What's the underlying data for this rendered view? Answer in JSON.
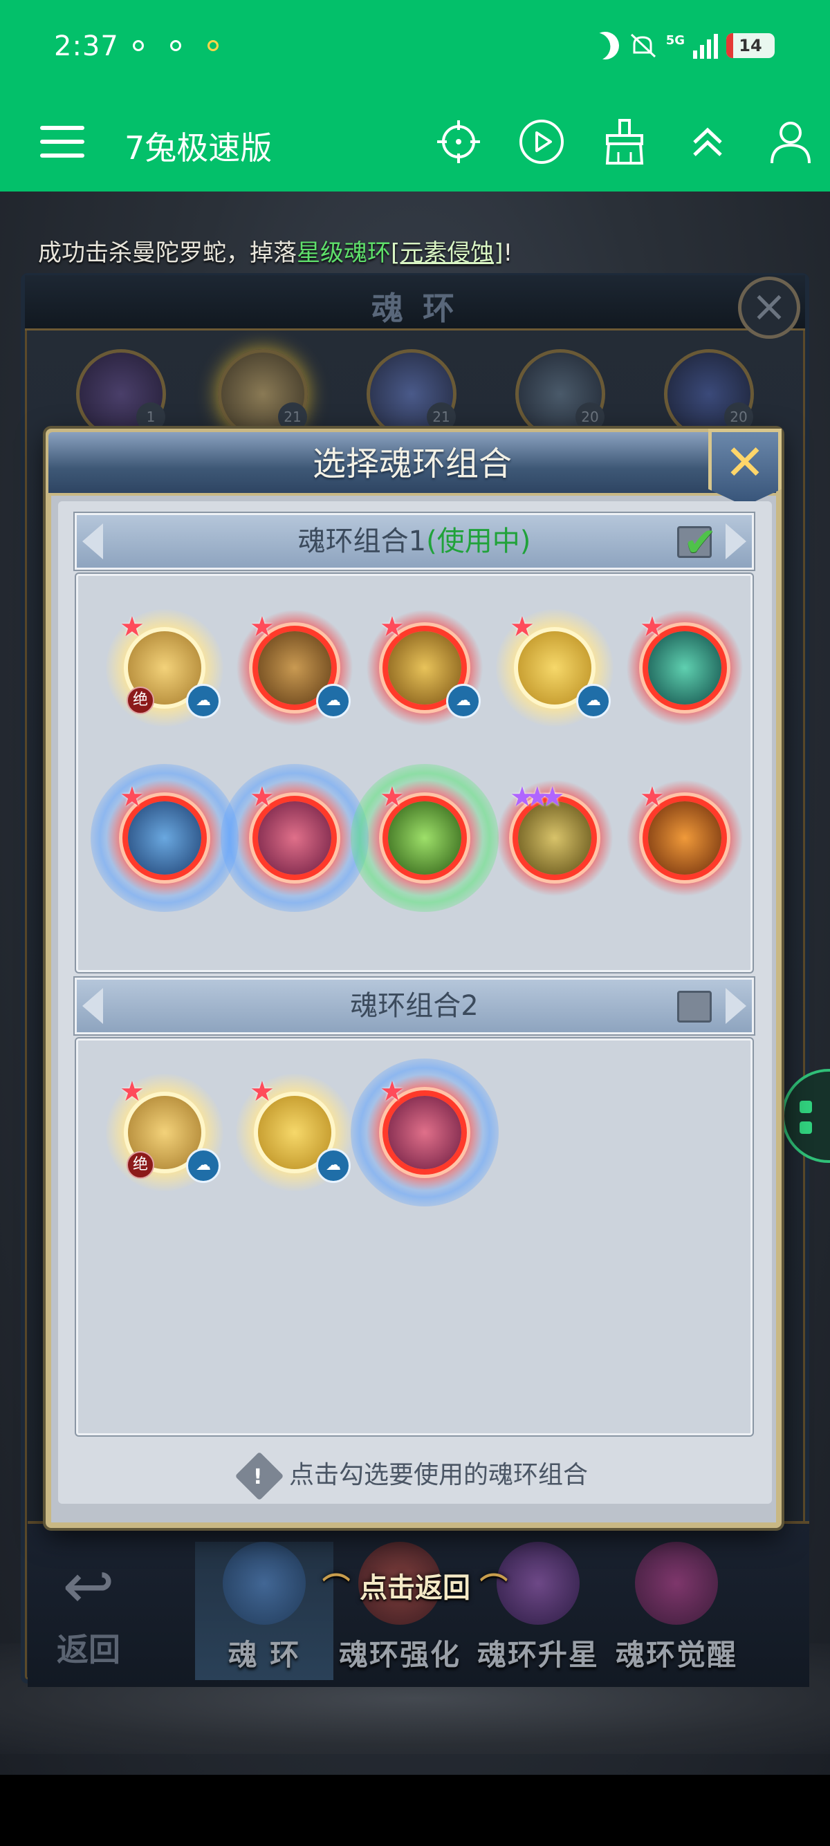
{
  "status_bar": {
    "time": "2:37",
    "network": "5G",
    "battery": "14",
    "battery_fraction": 0.14,
    "icons": [
      "moon-icon",
      "mute-icon",
      "signal-icon",
      "battery-icon"
    ]
  },
  "app_bar": {
    "title": "7兔极速版",
    "icons": [
      "menu-icon",
      "crosshair-icon",
      "play-icon",
      "broom-icon",
      "double-chevron-up-icon",
      "user-icon"
    ]
  },
  "ticker": {
    "prefix": "成功击杀曼陀罗蛇，掉落",
    "highlight": "星级魂环",
    "item": "[元素侵蚀]",
    "suffix": "!"
  },
  "back_panel": {
    "title": "魂 环",
    "avatar_levels": [
      "1",
      "21",
      "21",
      "20",
      "20"
    ]
  },
  "dialog": {
    "title": "选择魂环组合",
    "close_label": "✕",
    "group1": {
      "title": "魂环组合1",
      "status": "(使用中)",
      "checked": true,
      "rings": [
        {
          "style": "gold",
          "badge_jue": "绝",
          "cloud": true,
          "star": "★"
        },
        {
          "style": "red",
          "cloud": true,
          "star": "★"
        },
        {
          "style": "red",
          "cloud": true,
          "star": "★"
        },
        {
          "style": "gold",
          "cloud": true,
          "star": "★"
        },
        {
          "style": "red",
          "star": "★"
        },
        {
          "style": "red",
          "aura": "blue",
          "star": "★"
        },
        {
          "style": "red",
          "aura": "blue",
          "star": "★"
        },
        {
          "style": "red",
          "aura": "green",
          "star": "★"
        },
        {
          "style": "red",
          "star": "★★★",
          "star_color": "purple"
        },
        {
          "style": "red",
          "star": "★"
        }
      ]
    },
    "group2": {
      "title": "魂环组合2",
      "checked": false,
      "rings": [
        {
          "style": "gold",
          "badge_jue": "绝",
          "cloud": true,
          "star": "★"
        },
        {
          "style": "gold",
          "cloud": true,
          "star": "★"
        },
        {
          "style": "red",
          "aura": "blue",
          "star": "★"
        }
      ]
    },
    "hint": "点击勾选要使用的魂环组合",
    "hint_icon": "!"
  },
  "game_nav": {
    "back_label": "返回",
    "tap_back": "点击返回",
    "tabs": [
      "魂 环",
      "魂环强化",
      "魂环升星",
      "魂环觉醒"
    ]
  },
  "colors": {
    "app_green": "#03c06a",
    "in_use_green": "#20a23a",
    "ticker_green": "#5fe06b"
  }
}
